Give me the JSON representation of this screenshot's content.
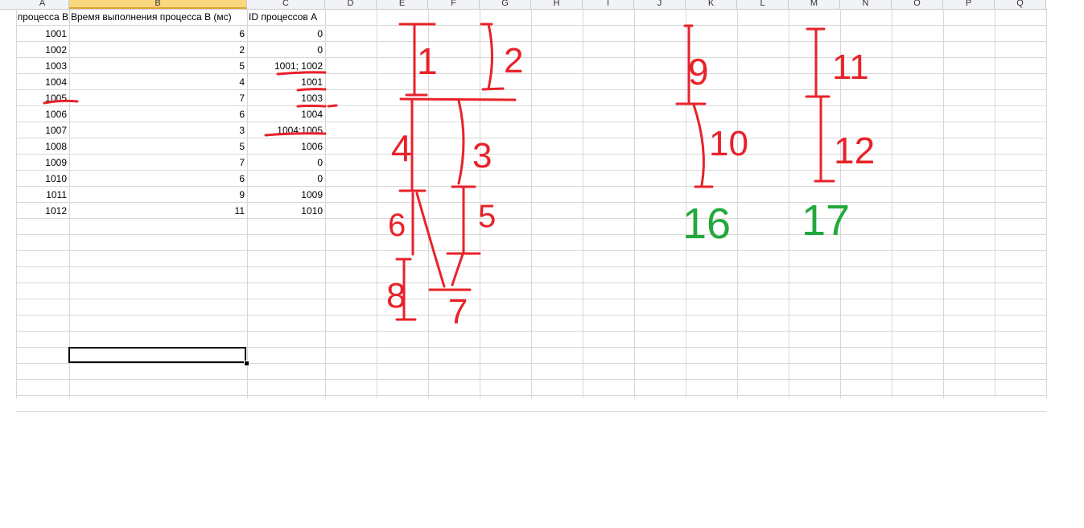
{
  "columns": [
    "A",
    "B",
    "C",
    "D",
    "E",
    "F",
    "G",
    "H",
    "I",
    "J",
    "K",
    "L",
    "M",
    "N",
    "O",
    "P",
    "Q"
  ],
  "selected_column": "B",
  "header_row": {
    "a": "процесса В",
    "b": "Время выполнения процесса В (мс)",
    "c": "ID процессов А"
  },
  "rows": [
    {
      "a": "1001",
      "b": "6",
      "c": "0"
    },
    {
      "a": "1002",
      "b": "2",
      "c": "0"
    },
    {
      "a": "1003",
      "b": "5",
      "c": "1001; 1002"
    },
    {
      "a": "1004",
      "b": "4",
      "c": "1001"
    },
    {
      "a": "1005",
      "b": "7",
      "c": "1003"
    },
    {
      "a": "1006",
      "b": "6",
      "c": "1004"
    },
    {
      "a": "1007",
      "b": "3",
      "c": "1004;1005"
    },
    {
      "a": "1008",
      "b": "5",
      "c": "1006"
    },
    {
      "a": "1009",
      "b": "7",
      "c": "0"
    },
    {
      "a": "1010",
      "b": "6",
      "c": "0"
    },
    {
      "a": "1011",
      "b": "9",
      "c": "1009"
    },
    {
      "a": "1012",
      "b": "11",
      "c": "1010"
    }
  ],
  "handwriting": {
    "labels_red": [
      "1",
      "2",
      "3",
      "4",
      "5",
      "6",
      "7",
      "8",
      "9",
      "10",
      "11",
      "12"
    ],
    "totals_green": [
      "16",
      "17"
    ],
    "ink_red": "#e8222a",
    "ink_green": "#23a83c"
  },
  "colors": {
    "grid": "#d8d8d8",
    "header_bg": "#f1f3f6",
    "header_selected": "#f8d77e"
  }
}
